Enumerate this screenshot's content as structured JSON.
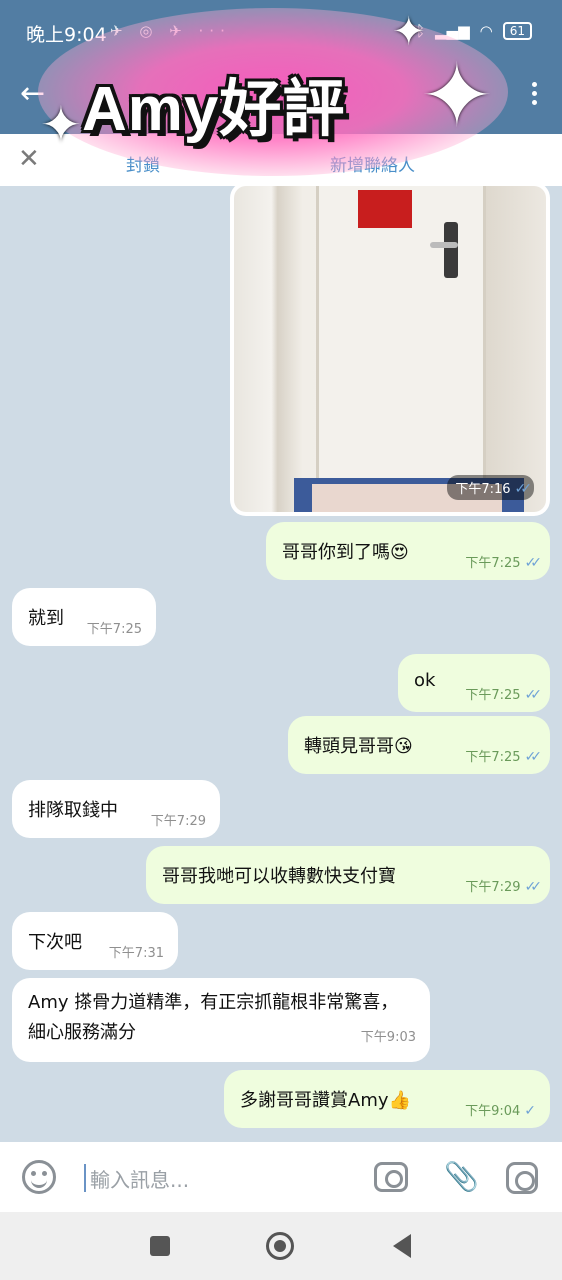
{
  "status_bar": {
    "time": "晚上9:04",
    "battery": "61"
  },
  "header": {
    "overlay_title": "Amy好評"
  },
  "action_bar": {
    "block_label": "封鎖",
    "add_contact_label": "新增聯絡人"
  },
  "chat": {
    "photo_time": "下午7:16",
    "messages": [
      {
        "dir": "out",
        "text": "哥哥你到了嗎😍",
        "time": "下午7:25",
        "status": "read"
      },
      {
        "dir": "in",
        "text": "就到",
        "time": "下午7:25"
      },
      {
        "dir": "out",
        "text": "ok",
        "time": "下午7:25",
        "status": "read"
      },
      {
        "dir": "out",
        "text": "轉頭見哥哥😘",
        "time": "下午7:25",
        "status": "read"
      },
      {
        "dir": "in",
        "text": "排隊取錢中",
        "time": "下午7:29"
      },
      {
        "dir": "out",
        "text": "哥哥我哋可以收轉數快支付寶",
        "time": "下午7:29",
        "status": "read"
      },
      {
        "dir": "in",
        "text": "下次吧",
        "time": "下午7:31"
      },
      {
        "dir": "in",
        "text": "Amy 搽骨力道精準，有正宗抓龍根非常驚喜，細心服務滿分",
        "time": "下午9:03"
      },
      {
        "dir": "out",
        "text": "多謝哥哥讚賞Amy👍",
        "time": "下午9:04",
        "status": "sent"
      }
    ]
  },
  "input": {
    "placeholder": "輸入訊息..."
  },
  "icons": {
    "back": "back-arrow-icon",
    "menu": "more-vert-icon",
    "close": "close-icon",
    "emoji": "emoji-icon",
    "camera": "camera-icon",
    "attach": "paperclip-icon",
    "instagram": "instagram-icon",
    "nav_recent": "recents-icon",
    "nav_home": "home-icon",
    "nav_back": "nav-back-icon"
  },
  "colors": {
    "header": "#527da3",
    "chat_bg": "#cfdbe5",
    "outgoing": "#effdde",
    "incoming": "#ffffff",
    "accent": "#4a8fc9"
  }
}
